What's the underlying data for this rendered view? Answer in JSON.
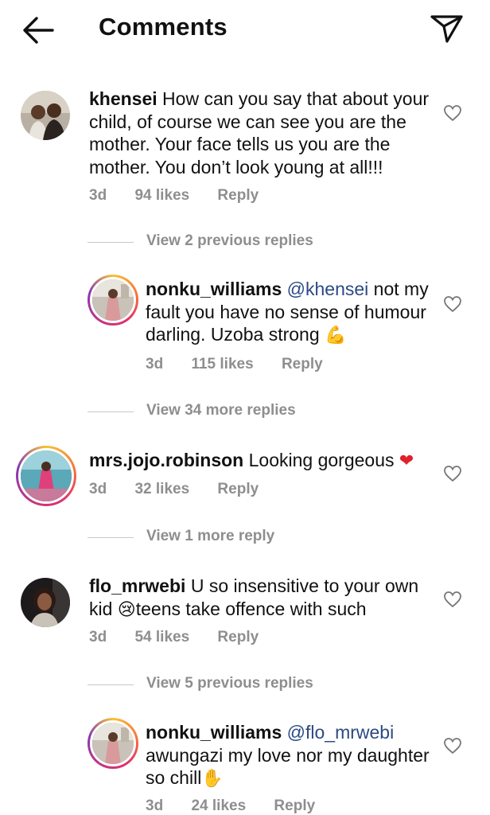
{
  "header": {
    "title": "Comments",
    "back_icon": "arrow-left-icon",
    "send_icon": "paper-plane-icon"
  },
  "comments": [
    {
      "username": "khensei",
      "text": "How can you say that about your child, of course we can see you are the mother. Your face tells us you are the mother. You don’t look young at all!!!",
      "time": "3d",
      "likes": "94 likes",
      "reply": "Reply",
      "after_view": "View 2 previous replies"
    },
    {
      "username": "nonku_williams",
      "mention": "@khensei",
      "text": "not my fault you have no sense of humour darling. Uzoba strong",
      "emoji": "💪",
      "time": "3d",
      "likes": "115 likes",
      "reply": "Reply",
      "after_view": "View 34 more replies"
    },
    {
      "username": "mrs.jojo.robinson",
      "text": "Looking gorgeous",
      "emoji": "❤",
      "time": "3d",
      "likes": "32 likes",
      "reply": "Reply",
      "after_view": "View 1 more reply"
    },
    {
      "username": "flo_mrwebi",
      "text1": "U so insensitive to your own kid",
      "emoji": "😢",
      "text2": "teens take offence with such",
      "time": "3d",
      "likes": "54 likes",
      "reply": "Reply",
      "after_view": "View 5 previous replies"
    },
    {
      "username": "nonku_williams",
      "mention": "@flo_mrwebi",
      "text": "awungazi my love nor my daughter so chill",
      "emoji": "✋",
      "time": "3d",
      "likes": "24 likes",
      "reply": "Reply"
    }
  ],
  "colors": {
    "accent_mention": "#2b4a83",
    "meta_gray": "#8e8e8e",
    "heart_red": "#e0202a"
  }
}
